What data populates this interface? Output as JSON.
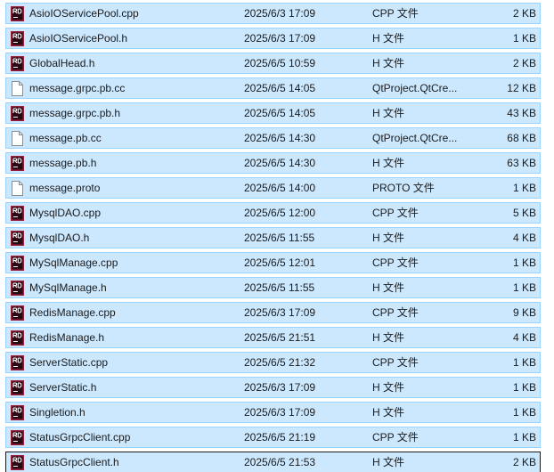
{
  "files": [
    {
      "name": "AsioIOServicePool.cpp",
      "date": "2025/6/3 17:09",
      "type": "CPP 文件",
      "size": "2 KB",
      "icon": "rd-file-icon"
    },
    {
      "name": "AsioIOServicePool.h",
      "date": "2025/6/3 17:09",
      "type": "H 文件",
      "size": "1 KB",
      "icon": "rd-file-icon"
    },
    {
      "name": "GlobalHead.h",
      "date": "2025/6/5 10:59",
      "type": "H 文件",
      "size": "2 KB",
      "icon": "rd-file-icon"
    },
    {
      "name": "message.grpc.pb.cc",
      "date": "2025/6/5 14:05",
      "type": "QtProject.QtCre...",
      "size": "12 KB",
      "icon": "blank-file-icon"
    },
    {
      "name": "message.grpc.pb.h",
      "date": "2025/6/5 14:05",
      "type": "H 文件",
      "size": "43 KB",
      "icon": "rd-file-icon"
    },
    {
      "name": "message.pb.cc",
      "date": "2025/6/5 14:30",
      "type": "QtProject.QtCre...",
      "size": "68 KB",
      "icon": "blank-file-icon"
    },
    {
      "name": "message.pb.h",
      "date": "2025/6/5 14:30",
      "type": "H 文件",
      "size": "63 KB",
      "icon": "rd-file-icon"
    },
    {
      "name": "message.proto",
      "date": "2025/6/5 14:00",
      "type": "PROTO 文件",
      "size": "1 KB",
      "icon": "blank-file-icon"
    },
    {
      "name": "MysqlDAO.cpp",
      "date": "2025/6/5 12:00",
      "type": "CPP 文件",
      "size": "5 KB",
      "icon": "rd-file-icon"
    },
    {
      "name": "MysqlDAO.h",
      "date": "2025/6/5 11:55",
      "type": "H 文件",
      "size": "4 KB",
      "icon": "rd-file-icon"
    },
    {
      "name": "MySqlManage.cpp",
      "date": "2025/6/5 12:01",
      "type": "CPP 文件",
      "size": "1 KB",
      "icon": "rd-file-icon"
    },
    {
      "name": "MySqlManage.h",
      "date": "2025/6/5 11:55",
      "type": "H 文件",
      "size": "1 KB",
      "icon": "rd-file-icon"
    },
    {
      "name": "RedisManage.cpp",
      "date": "2025/6/3 17:09",
      "type": "CPP 文件",
      "size": "9 KB",
      "icon": "rd-file-icon"
    },
    {
      "name": "RedisManage.h",
      "date": "2025/6/5 21:51",
      "type": "H 文件",
      "size": "4 KB",
      "icon": "rd-file-icon"
    },
    {
      "name": "ServerStatic.cpp",
      "date": "2025/6/5 21:32",
      "type": "CPP 文件",
      "size": "1 KB",
      "icon": "rd-file-icon"
    },
    {
      "name": "ServerStatic.h",
      "date": "2025/6/3 17:09",
      "type": "H 文件",
      "size": "1 KB",
      "icon": "rd-file-icon"
    },
    {
      "name": "Singletion.h",
      "date": "2025/6/3 17:09",
      "type": "H 文件",
      "size": "1 KB",
      "icon": "rd-file-icon"
    },
    {
      "name": "StatusGrpcClient.cpp",
      "date": "2025/6/5 21:19",
      "type": "CPP 文件",
      "size": "1 KB",
      "icon": "rd-file-icon"
    },
    {
      "name": "StatusGrpcClient.h",
      "date": "2025/6/5 21:53",
      "type": "H 文件",
      "size": "2 KB",
      "icon": "rd-file-icon",
      "focused": true
    }
  ],
  "colors": {
    "selection_bg": "#cce8ff",
    "selection_border": "#99d1ff",
    "rd_icon_bg": "#9b1c3b",
    "rd_icon_text": "#ffffff"
  }
}
